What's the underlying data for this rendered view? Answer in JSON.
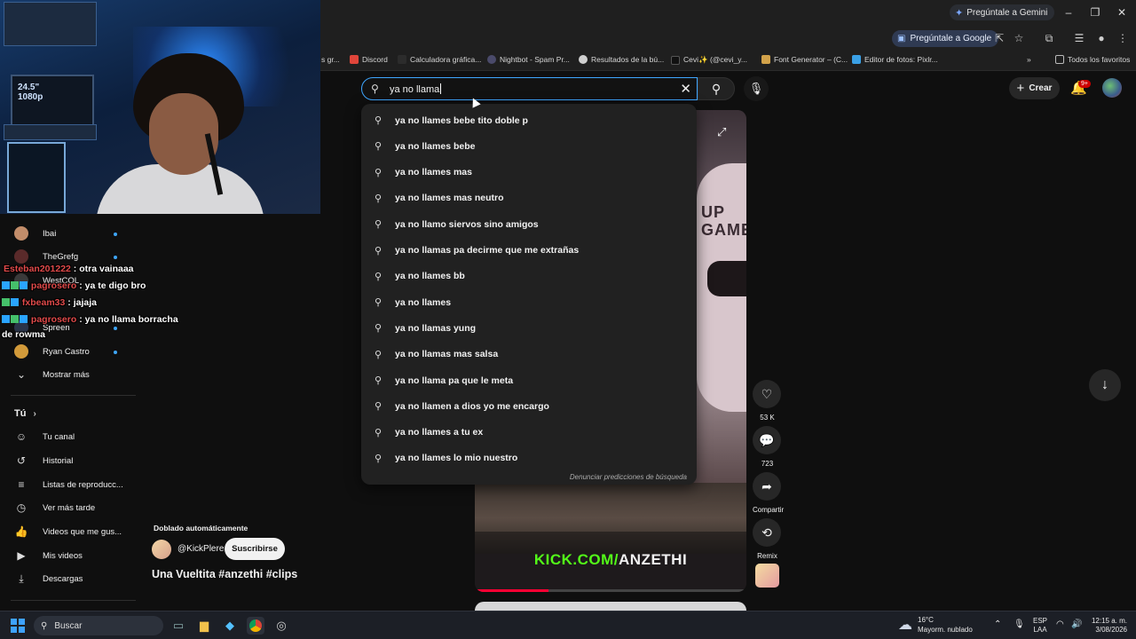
{
  "browser": {
    "gemini_button": "Pregúntale a Gemini",
    "google_button": "Pregúntale a Google",
    "bookmarks": [
      {
        "label": "s gr..."
      },
      {
        "label": "Discord"
      },
      {
        "label": "Calculadora gráfica..."
      },
      {
        "label": "Nightbot - Spam Pr..."
      },
      {
        "label": "Resultados de la bú..."
      },
      {
        "label": "Cevi✨ (@cevi_y..."
      },
      {
        "label": "Font Generator – (C..."
      },
      {
        "label": "Editor de fotos: Pixlr..."
      }
    ],
    "all_bookmarks": "Todos los favoritos"
  },
  "header": {
    "search_value": "ya no llama",
    "create_label": "Crear",
    "notifications_badge": "9+"
  },
  "suggestions": {
    "items": [
      "ya no llames bebe tito doble p",
      "ya no llames bebe",
      "ya no llames mas",
      "ya no llames mas neutro",
      "ya no llamo siervos sino amigos",
      "ya no llamas pa decirme que me extrañas",
      "ya no llames bb",
      "ya no llames",
      "ya no llamas yung",
      "ya no llamas mas salsa",
      "ya no llama pa que le meta",
      "ya no llamen a dios yo me encargo",
      "ya no llames a tu ex",
      "ya no llames lo mio nuestro"
    ],
    "report": "Denunciar predicciones de búsqueda"
  },
  "webcam": {
    "monitor_text": "24.5\" 1080p"
  },
  "sidebar": {
    "subscriptions": [
      {
        "label": "Ibai"
      },
      {
        "label": "TheGrefg"
      },
      {
        "label": "WestCOL"
      },
      {
        "label": "Spreen"
      },
      {
        "label": "Ryan Castro"
      }
    ],
    "show_more": "Mostrar más",
    "you_heading": "Tú",
    "you_items": [
      {
        "label": "Tu canal",
        "icon": "user-icon"
      },
      {
        "label": "Historial",
        "icon": "history-icon"
      },
      {
        "label": "Listas de reproducc...",
        "icon": "playlist-icon"
      },
      {
        "label": "Ver más tarde",
        "icon": "clock-icon"
      },
      {
        "label": "Videos que me gus...",
        "icon": "like-icon"
      },
      {
        "label": "Mis videos",
        "icon": "video-icon"
      },
      {
        "label": "Descargas",
        "icon": "download-icon"
      }
    ]
  },
  "chat": [
    {
      "user": "Esteban201222",
      "message": " : otra vainaaa"
    },
    {
      "user": "pagrosero",
      "message": " : ya te digo bro"
    },
    {
      "user": "fxbeam33",
      "message": " : jajaja"
    },
    {
      "user": "pagrosero",
      "message": " : ya no llama borracha"
    },
    {
      "message": "de rowma"
    }
  ],
  "short": {
    "dub_label": "Doblado automáticamente",
    "channel": "@KickPlere",
    "subscribe": "Suscribirse",
    "title": "Una Vueltita #anzethi #clips",
    "banner_green": "KICK.COM/",
    "banner_white": "ANZETHI",
    "progress": 0.27,
    "logo_text": "UP\nGAME",
    "actions": {
      "likes": "53 K",
      "comments": "723",
      "share": "Compartir",
      "remix": "Remix"
    }
  },
  "taskbar": {
    "search": "Buscar",
    "temp": "16°C",
    "weather": "Mayorm. nublado",
    "lang1": "ESP",
    "lang2": "LAA",
    "time": "12:15 a. m.",
    "date": "3/08/2026"
  },
  "colors": {
    "accent_blue": "#3ea6ff",
    "youtube_red": "#ff0033",
    "kick_green": "#53fc18"
  }
}
